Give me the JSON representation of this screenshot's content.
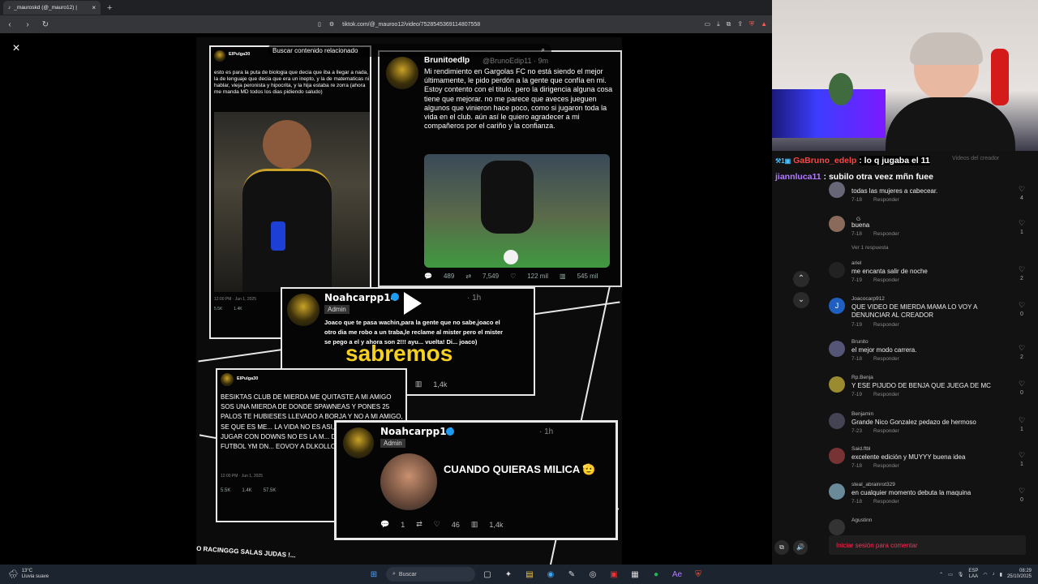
{
  "browser": {
    "tab_title": "_mauroskd (@_mauro12) | ",
    "tab_close": "×",
    "new_tab": "+",
    "url": "tiktok.com/@_mauroo12/video/7528545369114807558"
  },
  "viewer": {
    "close": "×",
    "search_label": "Buscar contenido relacionado"
  },
  "video": {
    "tweet_a": {
      "handle": "ElPulga30",
      "text": "esto es para la puta de biologia que decia que iba a llegar a nada, la de lenguaje que decia que era un inepto, y la de matematicas ni hablar, vieja peronista y hipocrita, y la hija estaba re zorra (ahora me manda MD todos los dias pidiendo saludo)",
      "date": "12:00 PM · Jun 1, 2025",
      "retweets": "5.5K",
      "quotes": "1.4K"
    },
    "tweet_b": {
      "name": "Brunitoedlp",
      "handle": "@BrunoEdip11 · 9m",
      "text": "Mi rendimiento en Gargolas FC no está siendo el mejor últimamente, le pido perdón a la gente que confía en mi. Estoy contento con el titulo. pero la dirigencia alguna cosa tiene que mejorar. no me parece que aveces jueguen algunos que vinieron hace poco, como si jugaron toda la vida en el club. aún así le quiero agradecer a mi compañeros por el cariño y la confianza.",
      "replies": "489",
      "retweets": "7,549",
      "likes": "122 mil",
      "views": "545 mil"
    },
    "tweet_c": {
      "name": "Noahcarpp14",
      "time": "· 1h",
      "badge": "Admin",
      "text": "Joaco que te pasa wachin,para la gente que no sabe,joaco el otro dia me robo a un traba,le reclame al mister pero el mister se pego a el y ahora son 2!!! ayu... vuelta! Di... joaco)",
      "caption": "sabremos",
      "replies": "1",
      "likes": "46",
      "views": "1,4k"
    },
    "tweet_d": {
      "handle": "ElPulga30",
      "text": "BESIKTAS CLUB DE MIERDA ME QUITASTE A MI AMIGO SOS UNA MIERDA DE DONDE SPAWNEAS Y PONES 25 PALOS TE HUBIESES LLEVADO A BORJA Y NO A MI AMIGO, SE QUE ES ME... LA VIDA NO ES ASI, IRTE A ESE C... JUGAR CON DOWNS NO ES LA M... DISFRUTAR DEL FUTBOL YM DN... EOVOY A DLKOLLORAR",
      "date": "12:00 PM · Jun 1, 2025",
      "retweets": "5.5K",
      "quotes": "1.4K",
      "extra": "57.5K"
    },
    "tweet_e": {
      "name": "Noahcarpp14",
      "time": "· 1h",
      "badge": "Admin",
      "text": "CUANDO QUIERAS MILICA 🫡",
      "replies": "1",
      "likes": "46",
      "views": "1,4k"
    },
    "bottom_text": "O RACINGGG SALAS JUDAS !..."
  },
  "chat": {
    "line1_user": "GaBruno_edelp",
    "line1_msg": ": lo q jugaba el 11",
    "line2_user": "jiannluca11",
    "line2_msg": ": subilo otra veez mñn fuee",
    "videos_label": "Videos del creador"
  },
  "comments": [
    {
      "user": "",
      "text": "todas las mujeres a cabecear.",
      "date": "7-18",
      "reply": "Responder",
      "likes": "4",
      "av": "#667"
    },
    {
      "user": "ㅤG",
      "text": "buena",
      "date": "7-18",
      "reply": "Responder",
      "likes": "1",
      "av": "#8a6a5a",
      "more": "Ver 1 respuesta"
    },
    {
      "user": "ariel",
      "text": "me encanta salir de noche",
      "date": "7-19",
      "reply": "Responder",
      "likes": "2",
      "av": "#222"
    },
    {
      "user": "Joacocarp912",
      "text": "QUE VIDEO DE MIERDA MAMA LO VOY A DENUNCIAR AL CREADOR",
      "date": "7-19",
      "reply": "Responder",
      "likes": "0",
      "av": "#1f5fbf",
      "initial": "J"
    },
    {
      "user": "Brunito",
      "text": "el mejor modo carrera.",
      "date": "7-18",
      "reply": "Responder",
      "likes": "2",
      "av": "#557"
    },
    {
      "user": "Rp.Benja",
      "text": "Y ESE PIJUDO DE BENJA QUE JUEGA DE MC",
      "date": "7-19",
      "reply": "Responder",
      "likes": "0",
      "av": "#9a8a30"
    },
    {
      "user": "Benjamin",
      "text": "Grande Nico Gonzalez pedazo de hermoso",
      "date": "7-23",
      "reply": "Responder",
      "likes": "1",
      "av": "#445"
    },
    {
      "user": "Said.ftbl",
      "text": "excelente edición y MUYYY buena idea",
      "date": "7-18",
      "reply": "Responder",
      "likes": "1",
      "av": "#733"
    },
    {
      "user": "steal_abrainrot329",
      "text": "en cualquier momento debuta la maquina",
      "date": "7-18",
      "reply": "Responder",
      "likes": "0",
      "av": "#6a8a9a"
    },
    {
      "user": "Agustinn",
      "text": "",
      "date": "",
      "reply": "",
      "likes": "",
      "av": "#333"
    }
  ],
  "login": "Iniciar sesión para comentar",
  "taskbar": {
    "weather_temp": "13°C",
    "weather_desc": "Lluvia suave",
    "search": "Buscar",
    "lang1": "ESP",
    "lang2": "LAA",
    "time": "08:29",
    "date": "25/10/2025"
  }
}
